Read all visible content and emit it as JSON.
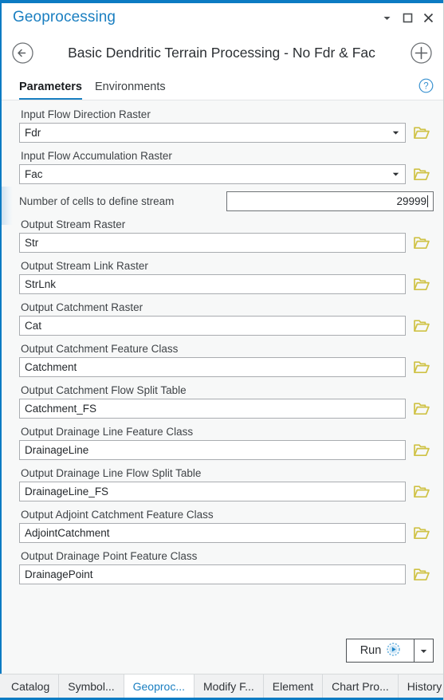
{
  "window": {
    "title": "Geoprocessing",
    "controls": [
      {
        "name": "minimize-dropdown",
        "icon": "chevron-down-icon"
      },
      {
        "name": "maximize",
        "icon": "maximize-icon"
      },
      {
        "name": "close",
        "icon": "close-icon"
      }
    ]
  },
  "tool_header": {
    "back_icon": "back-arrow-circle-icon",
    "title": "Basic Dendritic Terrain Processing - No Fdr & Fac",
    "add_icon": "plus-circle-icon"
  },
  "tabs": {
    "items": [
      {
        "label": "Parameters",
        "active": true
      },
      {
        "label": "Environments",
        "active": false
      }
    ],
    "help_icon": "help-circle-icon"
  },
  "parameters": [
    {
      "label": "Input Flow Direction Raster",
      "value": "Fdr",
      "type": "combo",
      "browse": true,
      "inline": false
    },
    {
      "label": "Input Flow Accumulation Raster",
      "value": "Fac",
      "type": "combo",
      "browse": true,
      "inline": false
    },
    {
      "label": "Number of cells to define stream",
      "value": "29999",
      "type": "number",
      "browse": false,
      "inline": true,
      "focused": true
    },
    {
      "label": "Output Stream Raster",
      "value": "Str",
      "type": "text",
      "browse": true,
      "inline": false
    },
    {
      "label": "Output Stream Link Raster",
      "value": "StrLnk",
      "type": "text",
      "browse": true,
      "inline": false
    },
    {
      "label": "Output Catchment Raster",
      "value": "Cat",
      "type": "text",
      "browse": true,
      "inline": false
    },
    {
      "label": "Output Catchment Feature Class",
      "value": "Catchment",
      "type": "text",
      "browse": true,
      "inline": false
    },
    {
      "label": "Output Catchment Flow Split Table",
      "value": "Catchment_FS",
      "type": "text",
      "browse": true,
      "inline": false
    },
    {
      "label": "Output Drainage Line Feature Class",
      "value": "DrainageLine",
      "type": "text",
      "browse": true,
      "inline": false
    },
    {
      "label": "Output Drainage Line Flow Split Table",
      "value": "DrainageLine_FS",
      "type": "text",
      "browse": true,
      "inline": false
    },
    {
      "label": "Output Adjoint Catchment Feature Class",
      "value": "AdjointCatchment",
      "type": "text",
      "browse": true,
      "inline": false
    },
    {
      "label": "Output Drainage Point Feature Class",
      "value": "DrainagePoint",
      "type": "text",
      "browse": true,
      "inline": false
    }
  ],
  "run": {
    "label": "Run",
    "run_icon": "play-circle-icon",
    "split_icon": "chevron-down-icon"
  },
  "bottom_tabs": [
    {
      "label": "Catalog",
      "active": false
    },
    {
      "label": "Symbol...",
      "active": false
    },
    {
      "label": "Geoproc...",
      "active": true
    },
    {
      "label": "Modify F...",
      "active": false
    },
    {
      "label": "Element",
      "active": false
    },
    {
      "label": "Chart Pro...",
      "active": false
    },
    {
      "label": "History",
      "active": false
    }
  ],
  "colors": {
    "accent_blue": "#0c7bc3",
    "title_blue": "#1a7fc1",
    "folder_yellow": "#cfc245",
    "panel_bg": "#f7f8f8",
    "field_border": "#a9acb0"
  }
}
